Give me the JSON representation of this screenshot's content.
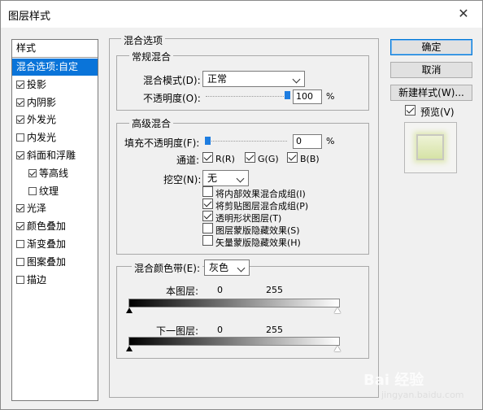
{
  "window": {
    "title": "图层样式",
    "close_glyph": "✕"
  },
  "style_list": {
    "header": "样式",
    "items": [
      {
        "label": "混合选项:自定",
        "checkbox": false,
        "checked": false,
        "indent": 0,
        "selected": true
      },
      {
        "label": "投影",
        "checkbox": true,
        "checked": true,
        "indent": 0
      },
      {
        "label": "内阴影",
        "checkbox": true,
        "checked": true,
        "indent": 0
      },
      {
        "label": "外发光",
        "checkbox": true,
        "checked": true,
        "indent": 0
      },
      {
        "label": "内发光",
        "checkbox": true,
        "checked": false,
        "indent": 0
      },
      {
        "label": "斜面和浮雕",
        "checkbox": true,
        "checked": true,
        "indent": 0
      },
      {
        "label": "等高线",
        "checkbox": true,
        "checked": true,
        "indent": 1
      },
      {
        "label": "纹理",
        "checkbox": true,
        "checked": false,
        "indent": 1
      },
      {
        "label": "光泽",
        "checkbox": true,
        "checked": true,
        "indent": 0
      },
      {
        "label": "颜色叠加",
        "checkbox": true,
        "checked": true,
        "indent": 0
      },
      {
        "label": "渐变叠加",
        "checkbox": true,
        "checked": false,
        "indent": 0
      },
      {
        "label": "图案叠加",
        "checkbox": true,
        "checked": false,
        "indent": 0
      },
      {
        "label": "描边",
        "checkbox": true,
        "checked": false,
        "indent": 0
      }
    ]
  },
  "blend_options": {
    "title": "混合选项",
    "general": {
      "title": "常规混合",
      "mode_label": "混合模式(D):",
      "mode_value": "正常",
      "opacity_label": "不透明度(O):",
      "opacity_value": "100",
      "opacity_unit": "%",
      "opacity_fraction": 1.0
    },
    "advanced": {
      "title": "高级混合",
      "fill_label": "填充不透明度(F):",
      "fill_value": "0",
      "fill_unit": "%",
      "fill_fraction": 0.0,
      "channels_label": "通道:",
      "channels": [
        {
          "label": "R(R)",
          "checked": true
        },
        {
          "label": "G(G)",
          "checked": true
        },
        {
          "label": "B(B)",
          "checked": true
        }
      ],
      "knockout_label": "挖空(N):",
      "knockout_value": "无",
      "options": [
        {
          "label": "将内部效果混合成组(I)",
          "checked": false
        },
        {
          "label": "将剪贴图层混合成组(P)",
          "checked": true
        },
        {
          "label": "透明形状图层(T)",
          "checked": true
        },
        {
          "label": "图层蒙版隐藏效果(S)",
          "checked": false
        },
        {
          "label": "矢量蒙版隐藏效果(H)",
          "checked": false
        }
      ]
    },
    "blend_if": {
      "label": "混合颜色带(E):",
      "value": "灰色",
      "this_layer_label": "本图层:",
      "this_layer_low": "0",
      "this_layer_high": "255",
      "underlying_label": "下一图层:",
      "underlying_low": "0",
      "underlying_high": "255"
    }
  },
  "buttons": {
    "ok": "确定",
    "cancel": "取消",
    "new_style": "新建样式(W)...",
    "preview_label": "预览(V)",
    "preview_checked": true
  },
  "watermark": {
    "text": "Bai  经验",
    "sub": "jingyan.baidu.com"
  }
}
